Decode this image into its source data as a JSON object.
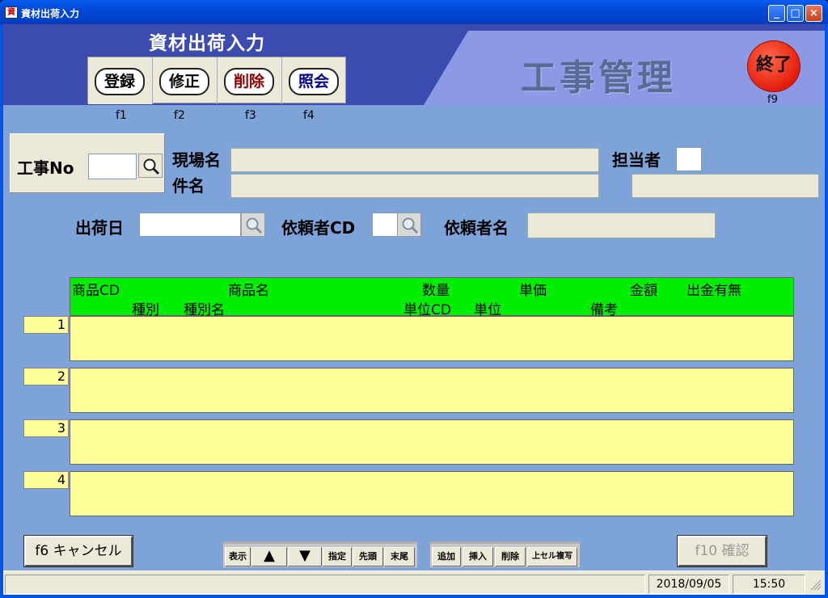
{
  "window": {
    "title": "資材出荷入力",
    "minimize": "_",
    "maximize": "□",
    "close": "×"
  },
  "header": {
    "screen_title": "資材出荷入力",
    "module_title": "工事管理",
    "modes": [
      {
        "label": "登録",
        "fkey": "f1",
        "color": "#000000"
      },
      {
        "label": "修正",
        "fkey": "f2",
        "color": "#000000"
      },
      {
        "label": "削除",
        "fkey": "f3",
        "color": "#8b0000"
      },
      {
        "label": "照会",
        "fkey": "f4",
        "color": "#00008b"
      }
    ],
    "exit": {
      "label": "終了",
      "fkey": "f9"
    }
  },
  "form": {
    "koji_no_label": "工事No",
    "koji_no_value": "",
    "genba_label": "現場名",
    "genba_value": "",
    "kenmei_label": "件名",
    "kenmei_value": "",
    "tanto_label": "担当者",
    "tanto_code": "",
    "tanto_name": "",
    "shukka_label": "出荷日",
    "shukka_value": "",
    "irai_cd_label": "依頼者CD",
    "irai_cd_value": "",
    "irai_name_label": "依頼者名",
    "irai_name_value": ""
  },
  "grid": {
    "header_row1": [
      "商品CD",
      "商品名",
      "数量",
      "単価",
      "金額",
      "出金有無"
    ],
    "header_row2": [
      "種別",
      "種別名",
      "単位CD",
      "単位",
      "備考"
    ],
    "rows": [
      "1",
      "2",
      "3",
      "4"
    ]
  },
  "footer": {
    "cancel_label": "f6 キャンセル",
    "confirm_label": "f10 確認",
    "nav": {
      "display": "表示",
      "up": "▲",
      "down": "▼",
      "specify": "指定",
      "first": "先頭",
      "last": "末尾"
    },
    "edit": {
      "add": "追加",
      "insert": "挿入",
      "delete": "削除",
      "copy_above": "上セル複写"
    }
  },
  "status": {
    "date": "2018/09/05",
    "time": "15:50"
  }
}
